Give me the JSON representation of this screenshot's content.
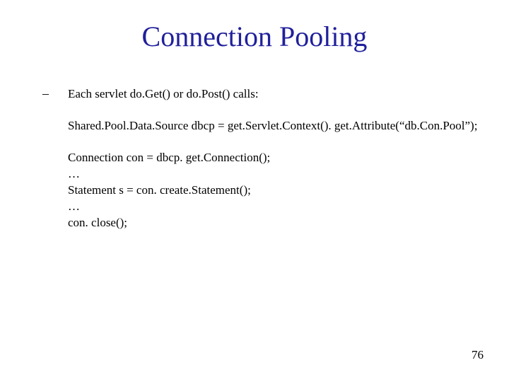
{
  "title": "Connection Pooling",
  "bullet_dash": "–",
  "lines": {
    "intro": "Each servlet do.Get() or do.Post() calls:",
    "declare": "Shared.Pool.Data.Source dbcp = get.Servlet.Context(). get.Attribute(“db.Con.Pool”);",
    "conn": "Connection con = dbcp. get.Connection();",
    "ell1": "…",
    "stmt": "Statement s = con. create.Statement();",
    "ell2": "…",
    "close": "con. close();"
  },
  "page_number": "76"
}
